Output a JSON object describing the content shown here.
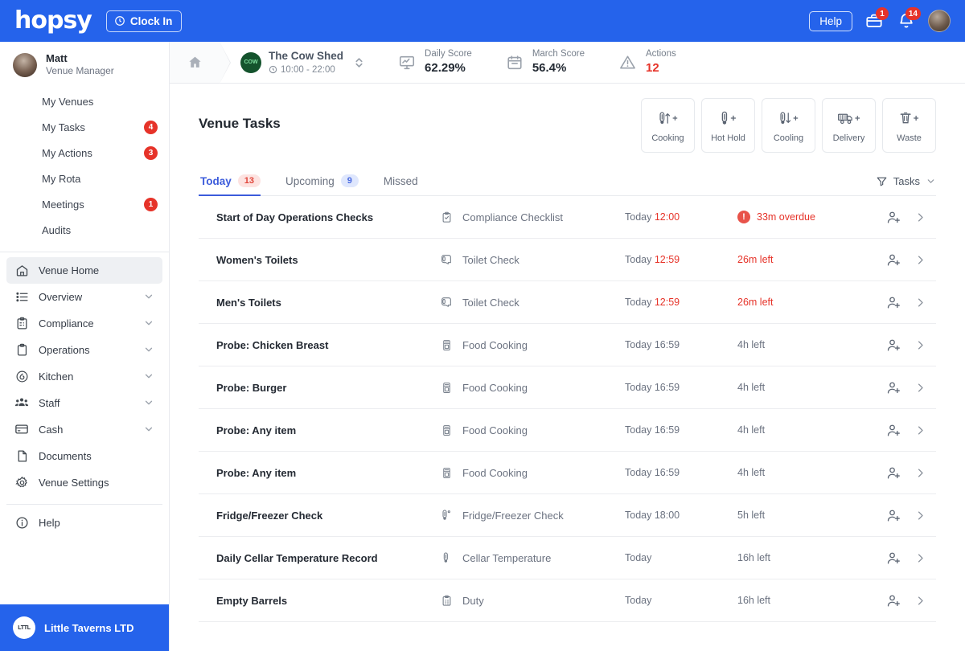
{
  "topbar": {
    "logo": "hopsy",
    "clock_in_label": "Clock In",
    "help_label": "Help",
    "briefcase_badge": "1",
    "bell_badge": "14",
    "accent_color": "#2563eb"
  },
  "sidebar": {
    "profile": {
      "name": "Matt",
      "role": "Venue Manager"
    },
    "personal_items": [
      {
        "label": "My Venues",
        "badge": ""
      },
      {
        "label": "My Tasks",
        "badge": "4"
      },
      {
        "label": "My Actions",
        "badge": "3"
      },
      {
        "label": "My Rota",
        "badge": ""
      },
      {
        "label": "Meetings",
        "badge": "1"
      },
      {
        "label": "Audits",
        "badge": ""
      }
    ],
    "main_items": [
      {
        "label": "Venue Home",
        "icon": "home-icon",
        "expandable": false,
        "active": true
      },
      {
        "label": "Overview",
        "icon": "list-icon",
        "expandable": true,
        "active": false
      },
      {
        "label": "Compliance",
        "icon": "clipboard-check-icon",
        "expandable": true,
        "active": false
      },
      {
        "label": "Operations",
        "icon": "clipboard-icon",
        "expandable": true,
        "active": false
      },
      {
        "label": "Kitchen",
        "icon": "flame-icon",
        "expandable": true,
        "active": false
      },
      {
        "label": "Staff",
        "icon": "people-icon",
        "expandable": true,
        "active": false
      },
      {
        "label": "Cash",
        "icon": "card-icon",
        "expandable": true,
        "active": false
      },
      {
        "label": "Documents",
        "icon": "document-icon",
        "expandable": false,
        "active": false
      },
      {
        "label": "Venue Settings",
        "icon": "gear-icon",
        "expandable": false,
        "active": false
      },
      {
        "label": "Help",
        "icon": "info-icon",
        "expandable": false,
        "active": false
      }
    ],
    "org_name": "Little Taverns LTD"
  },
  "breadcrumb": {
    "venue_name": "The Cow Shed",
    "venue_hours": "10:00 - 22:00",
    "stats": [
      {
        "label": "Daily Score",
        "value": "62.29%",
        "icon": "presentation-chart-icon",
        "danger": false
      },
      {
        "label": "March Score",
        "value": "56.4%",
        "icon": "calendar-icon",
        "danger": false
      },
      {
        "label": "Actions",
        "value": "12",
        "icon": "warning-triangle-icon",
        "danger": true
      }
    ]
  },
  "quick_actions": [
    {
      "label": "Cooking",
      "icon": "thermometer-up-icon"
    },
    {
      "label": "Hot Hold",
      "icon": "thermometer-icon"
    },
    {
      "label": "Cooling",
      "icon": "thermometer-down-icon"
    },
    {
      "label": "Delivery",
      "icon": "truck-icon"
    },
    {
      "label": "Waste",
      "icon": "trash-icon"
    }
  ],
  "main": {
    "page_title": "Venue Tasks",
    "tabs": [
      {
        "label": "Today",
        "badge": "13",
        "badge_color": "red",
        "active": true
      },
      {
        "label": "Upcoming",
        "badge": "9",
        "badge_color": "blue",
        "active": false
      },
      {
        "label": "Missed",
        "badge": "",
        "badge_color": "",
        "active": false
      }
    ],
    "filter_label": "Tasks"
  },
  "tasks": [
    {
      "name": "Start of Day Operations Checks",
      "type": "Compliance Checklist",
      "type_icon": "clipboard-check-icon",
      "due_prefix": "Today",
      "due_time": "12:00",
      "status": "33m overdue",
      "urgent": true,
      "alert": true
    },
    {
      "name": "Women's Toilets",
      "type": "Toilet Check",
      "type_icon": "toilet-roll-icon",
      "due_prefix": "Today",
      "due_time": "12:59",
      "status": "26m left",
      "urgent": true,
      "alert": false
    },
    {
      "name": "Men's Toilets",
      "type": "Toilet Check",
      "type_icon": "toilet-roll-icon",
      "due_prefix": "Today",
      "due_time": "12:59",
      "status": "26m left",
      "urgent": true,
      "alert": false
    },
    {
      "name": "Probe: Chicken Breast",
      "type": "Food Cooking",
      "type_icon": "oven-icon",
      "due_prefix": "Today 16:59",
      "due_time": "",
      "status": "4h left",
      "urgent": false,
      "alert": false
    },
    {
      "name": "Probe: Burger",
      "type": "Food Cooking",
      "type_icon": "oven-icon",
      "due_prefix": "Today 16:59",
      "due_time": "",
      "status": "4h left",
      "urgent": false,
      "alert": false
    },
    {
      "name": "Probe: Any item",
      "type": "Food Cooking",
      "type_icon": "oven-icon",
      "due_prefix": "Today 16:59",
      "due_time": "",
      "status": "4h left",
      "urgent": false,
      "alert": false
    },
    {
      "name": "Probe: Any item",
      "type": "Food Cooking",
      "type_icon": "oven-icon",
      "due_prefix": "Today 16:59",
      "due_time": "",
      "status": "4h left",
      "urgent": false,
      "alert": false
    },
    {
      "name": "Fridge/Freezer Check",
      "type": "Fridge/Freezer Check",
      "type_icon": "thermometer-degree-icon",
      "due_prefix": "Today 18:00",
      "due_time": "",
      "status": "5h left",
      "urgent": false,
      "alert": false
    },
    {
      "name": "Daily Cellar Temperature Record",
      "type": "Cellar Temperature",
      "type_icon": "thermometer-icon",
      "due_prefix": "Today",
      "due_time": "",
      "status": "16h left",
      "urgent": false,
      "alert": false
    },
    {
      "name": "Empty Barrels",
      "type": "Duty",
      "type_icon": "clipboard-lines-icon",
      "due_prefix": "Today",
      "due_time": "",
      "status": "16h left",
      "urgent": false,
      "alert": false
    }
  ]
}
